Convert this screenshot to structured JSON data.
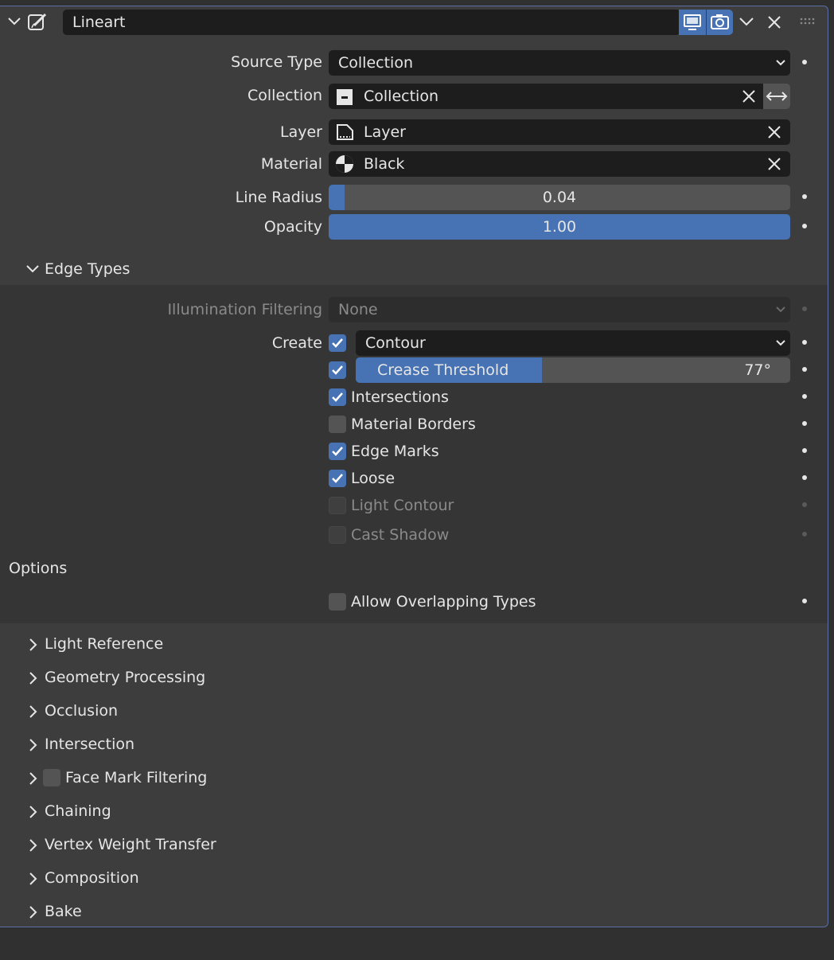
{
  "header": {
    "name_value": "Lineart",
    "icons": [
      "collapse-chevron-icon",
      "grease-pencil-modifier-icon",
      "viewport-display-icon",
      "render-camera-icon",
      "dropdown-chevron-icon",
      "close-icon",
      "drag-grip-icon"
    ]
  },
  "source_type": {
    "label": "Source Type",
    "value": "Collection"
  },
  "collection": {
    "label": "Collection",
    "value": "Collection"
  },
  "layer": {
    "label": "Layer",
    "value": "Layer"
  },
  "material": {
    "label": "Material",
    "value": "Black"
  },
  "line_radius": {
    "label": "Line Radius",
    "value": "0.04",
    "fraction": 0.035
  },
  "opacity": {
    "label": "Opacity",
    "value": "1.00",
    "fraction": 1.0
  },
  "edge_types": {
    "title": "Edge Types",
    "illumination": {
      "label": "Illumination Filtering",
      "value": "None"
    },
    "create_label": "Create",
    "contour": {
      "checked": true,
      "value": "Contour"
    },
    "crease": {
      "checked": true,
      "label": "Crease Threshold",
      "value": "77°",
      "fraction": 0.428
    },
    "items": [
      {
        "label": "Intersections",
        "checked": true,
        "enabled": true
      },
      {
        "label": "Material Borders",
        "checked": false,
        "enabled": true
      },
      {
        "label": "Edge Marks",
        "checked": true,
        "enabled": true
      },
      {
        "label": "Loose",
        "checked": true,
        "enabled": true
      },
      {
        "label": "Light Contour",
        "checked": false,
        "enabled": false
      },
      {
        "label": "Cast Shadow",
        "checked": false,
        "enabled": false
      }
    ],
    "options_title": "Options",
    "allow_overlapping": {
      "label": "Allow Overlapping Types",
      "checked": false
    }
  },
  "subpanels": [
    {
      "label": "Light Reference"
    },
    {
      "label": "Geometry Processing"
    },
    {
      "label": "Occlusion"
    },
    {
      "label": "Intersection"
    },
    {
      "label": "Face Mark Filtering",
      "checkbox": true
    },
    {
      "label": "Chaining"
    },
    {
      "label": "Vertex Weight Transfer"
    },
    {
      "label": "Composition"
    },
    {
      "label": "Bake"
    }
  ],
  "colors": {
    "accent": "#4772b3",
    "panel": "#3d3d3d",
    "field": "#1d1d1d",
    "border": "#5a6ea8"
  }
}
